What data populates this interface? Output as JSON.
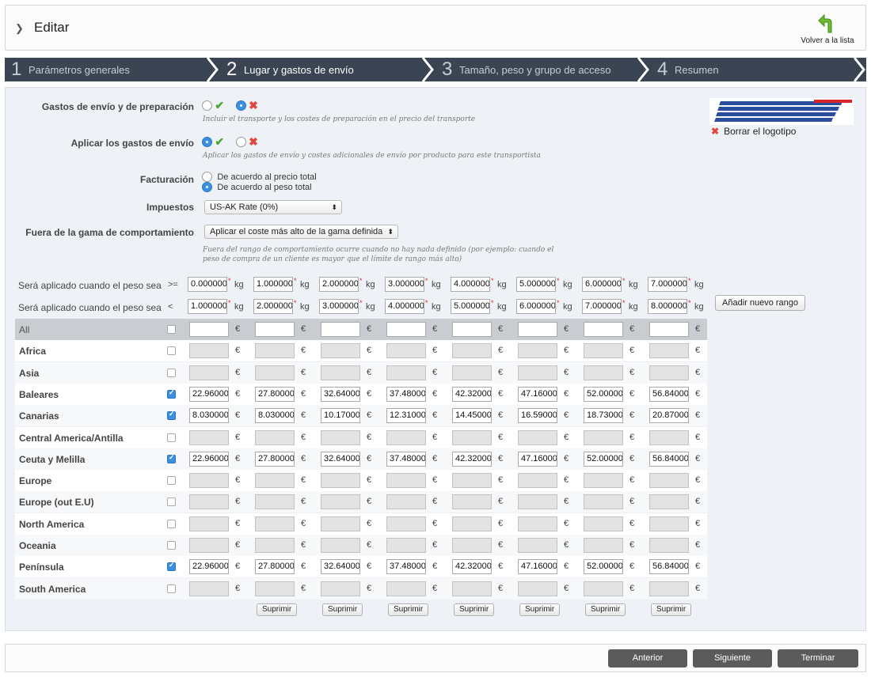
{
  "header": {
    "title": "Editar",
    "back_label": "Volver a la lista"
  },
  "steps": [
    {
      "num": "1",
      "label": "Parámetros generales"
    },
    {
      "num": "2",
      "label": "Lugar y gastos de envío"
    },
    {
      "num": "3",
      "label": "Tamaño, peso y grupo de acceso"
    },
    {
      "num": "4",
      "label": "Resumen"
    }
  ],
  "form": {
    "shipping_handling": {
      "label": "Gastos de envío y de preparación",
      "hint": "Incluir el transporte y los costes de preparación en el precio del transporte",
      "selected": "no"
    },
    "apply_shipping": {
      "label": "Aplicar los gastos de envío",
      "hint": "Aplicar los gastos de envío y costes adicionales de envío por producto para este transportista",
      "selected": "yes"
    },
    "billing": {
      "label": "Facturación",
      "options": [
        "De acuerdo al precio total",
        "De acuerdo al peso total"
      ],
      "selected": 1
    },
    "tax": {
      "label": "Impuestos",
      "value": "US-AK Rate (0%)"
    },
    "out_of_range": {
      "label": "Fuera de la gama de comportamiento",
      "value": "Aplicar el coste más alto de la gama definida",
      "hint": "Fuera del rango de comportamiento ocurre cuando no hay nada definido (por ejemplo: cuando el peso de compra de un cliente es mayor que el límite de rango más alto)"
    }
  },
  "logo": {
    "brand": "MRW",
    "delete_label": "Borrar el logotipo"
  },
  "ranges": {
    "label_from": "Será aplicado cuando el peso sea",
    "label_to": "Será aplicado cuando el peso sea",
    "op_from": ">=",
    "op_to": "<",
    "unit": "kg",
    "from": [
      "0.000000",
      "1.000000",
      "2.000000",
      "3.000000",
      "4.000000",
      "5.000000",
      "6.000000",
      "7.000000"
    ],
    "to": [
      "1.000000",
      "2.000000",
      "3.000000",
      "4.000000",
      "5.000000",
      "6.000000",
      "7.000000",
      "8.000000"
    ],
    "add_label": "Añadir nuevo rango"
  },
  "currency": "€",
  "zones": [
    {
      "name": "All",
      "checked": false,
      "prices": [
        "",
        "",
        "",
        "",
        "",
        "",
        "",
        ""
      ]
    },
    {
      "name": "Africa",
      "checked": false,
      "prices": [
        "",
        "",
        "",
        "",
        "",
        "",
        "",
        ""
      ]
    },
    {
      "name": "Asia",
      "checked": false,
      "prices": [
        "",
        "",
        "",
        "",
        "",
        "",
        "",
        ""
      ]
    },
    {
      "name": "Baleares",
      "checked": true,
      "prices": [
        "22.960000",
        "27.800000",
        "32.640000",
        "37.480000",
        "42.320000",
        "47.160000",
        "52.000000",
        "56.840000"
      ]
    },
    {
      "name": "Canarias",
      "checked": true,
      "prices": [
        "8.030000",
        "8.030000",
        "10.170000",
        "12.310000",
        "14.450000",
        "16.590000",
        "18.730000",
        "20.870000"
      ]
    },
    {
      "name": "Central America/Antilla",
      "checked": false,
      "prices": [
        "",
        "",
        "",
        "",
        "",
        "",
        "",
        ""
      ]
    },
    {
      "name": "Ceuta y Melilla",
      "checked": true,
      "prices": [
        "22.960000",
        "27.800000",
        "32.640000",
        "37.480000",
        "42.320000",
        "47.160000",
        "52.000000",
        "56.840000"
      ]
    },
    {
      "name": "Europe",
      "checked": false,
      "prices": [
        "",
        "",
        "",
        "",
        "",
        "",
        "",
        ""
      ]
    },
    {
      "name": "Europe (out E.U)",
      "checked": false,
      "prices": [
        "",
        "",
        "",
        "",
        "",
        "",
        "",
        ""
      ]
    },
    {
      "name": "North America",
      "checked": false,
      "prices": [
        "",
        "",
        "",
        "",
        "",
        "",
        "",
        ""
      ]
    },
    {
      "name": "Oceania",
      "checked": false,
      "prices": [
        "",
        "",
        "",
        "",
        "",
        "",
        "",
        ""
      ]
    },
    {
      "name": "Península",
      "checked": true,
      "prices": [
        "22.960000",
        "27.800000",
        "32.640000",
        "37.480000",
        "42.320000",
        "47.160000",
        "52.000000",
        "56.840000"
      ]
    },
    {
      "name": "South America",
      "checked": false,
      "prices": [
        "",
        "",
        "",
        "",
        "",
        "",
        "",
        ""
      ]
    }
  ],
  "delete_label": "Suprimir",
  "footer": {
    "prev": "Anterior",
    "next": "Siguiente",
    "finish": "Terminar"
  }
}
